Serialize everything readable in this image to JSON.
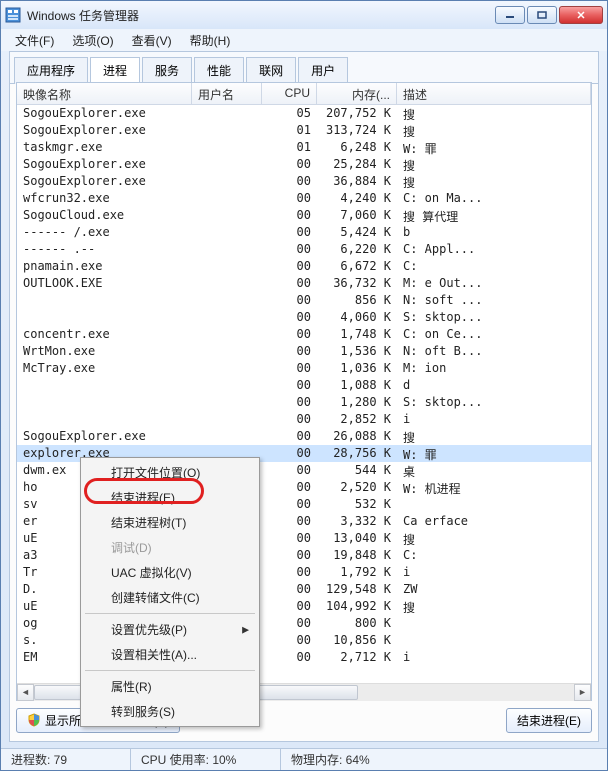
{
  "window": {
    "title": "Windows 任务管理器"
  },
  "menubar": [
    "文件(F)",
    "选项(O)",
    "查看(V)",
    "帮助(H)"
  ],
  "tabs": [
    "应用程序",
    "进程",
    "服务",
    "性能",
    "联网",
    "用户"
  ],
  "active_tab": 1,
  "columns": [
    "映像名称",
    "用户名",
    "CPU",
    "内存(...",
    "描述"
  ],
  "rows": [
    {
      "name": "SogouExplorer.exe",
      "user": "",
      "cpu": "05",
      "mem": "207,752 K",
      "desc": "搜"
    },
    {
      "name": "SogouExplorer.exe",
      "user": "",
      "cpu": "01",
      "mem": "313,724 K",
      "desc": "搜"
    },
    {
      "name": "taskmgr.exe",
      "user": "",
      "cpu": "01",
      "mem": "6,248 K",
      "desc": "W:             罪"
    },
    {
      "name": "SogouExplorer.exe",
      "user": "",
      "cpu": "00",
      "mem": "25,284 K",
      "desc": "搜"
    },
    {
      "name": "SogouExplorer.exe",
      "user": "",
      "cpu": "00",
      "mem": "36,884 K",
      "desc": "搜"
    },
    {
      "name": "wfcrun32.exe",
      "user": "",
      "cpu": "00",
      "mem": "4,240 K",
      "desc": "C:          on Ma..."
    },
    {
      "name": "SogouCloud.exe",
      "user": "",
      "cpu": "00",
      "mem": "7,060 K",
      "desc": "搜          算代理"
    },
    {
      "name": "------ /.exe",
      "user": "",
      "cpu": "00",
      "mem": "5,424 K",
      "desc": "b"
    },
    {
      "name": "------ .--",
      "user": "",
      "cpu": "00",
      "mem": "6,220 K",
      "desc": "C:           Appl..."
    },
    {
      "name": "pnamain.exe",
      "user": "",
      "cpu": "00",
      "mem": "6,672 K",
      "desc": "C:"
    },
    {
      "name": "OUTLOOK.EXE",
      "user": "",
      "cpu": "00",
      "mem": "36,732 K",
      "desc": "M:          e Out..."
    },
    {
      "name": "",
      "user": "",
      "cpu": "00",
      "mem": "856 K",
      "desc": "N:          soft ..."
    },
    {
      "name": "",
      "user": "",
      "cpu": "00",
      "mem": "4,060 K",
      "desc": "S:          sktop..."
    },
    {
      "name": "concentr.exe",
      "user": "",
      "cpu": "00",
      "mem": "1,748 K",
      "desc": "C:          on Ce..."
    },
    {
      "name": "WrtMon.exe",
      "user": "",
      "cpu": "00",
      "mem": "1,536 K",
      "desc": "N:          oft B..."
    },
    {
      "name": "McTray.exe",
      "user": "",
      "cpu": "00",
      "mem": "1,036 K",
      "desc": "M:          ion"
    },
    {
      "name": "",
      "user": "",
      "cpu": "00",
      "mem": "1,088 K",
      "desc": "d"
    },
    {
      "name": "",
      "user": "",
      "cpu": "00",
      "mem": "1,280 K",
      "desc": "S:          sktop..."
    },
    {
      "name": "",
      "user": "",
      "cpu": "00",
      "mem": "2,852 K",
      "desc": "i"
    },
    {
      "name": "SogouExplorer.exe",
      "user": "",
      "cpu": "00",
      "mem": "26,088 K",
      "desc": "搜"
    },
    {
      "name": "explorer.exe",
      "user": "",
      "cpu": "00",
      "mem": "28,756 K",
      "desc": "W:             罪",
      "selected": true
    },
    {
      "name": "dwm.ex",
      "user": "",
      "cpu": "00",
      "mem": "544 K",
      "desc": "桌"
    },
    {
      "name": "ho",
      "user": "",
      "cpu": "00",
      "mem": "2,520 K",
      "desc": "W:          机进程"
    },
    {
      "name": "sv",
      "user": "",
      "cpu": "00",
      "mem": "532 K",
      "desc": ""
    },
    {
      "name": "er",
      "user": "",
      "cpu": "00",
      "mem": "3,332 K",
      "desc": "Ca          erface"
    },
    {
      "name": "uE",
      "user": "",
      "cpu": "00",
      "mem": "13,040 K",
      "desc": "搜"
    },
    {
      "name": "a3",
      "user": "",
      "cpu": "00",
      "mem": "19,848 K",
      "desc": "C:"
    },
    {
      "name": "Tr",
      "user": "",
      "cpu": "00",
      "mem": "1,792 K",
      "desc": "i"
    },
    {
      "name": "D.",
      "user": "",
      "cpu": "00",
      "mem": "129,548 K",
      "desc": "ZW"
    },
    {
      "name": "uE",
      "user": "",
      "cpu": "00",
      "mem": "104,992 K",
      "desc": "搜"
    },
    {
      "name": "og",
      "user": "",
      "cpu": "00",
      "mem": "800 K",
      "desc": ""
    },
    {
      "name": "s.",
      "user": "",
      "cpu": "00",
      "mem": "10,856 K",
      "desc": ""
    },
    {
      "name": "EM",
      "user": "",
      "cpu": "00",
      "mem": "2,712 K",
      "desc": "i"
    }
  ],
  "context_menu": {
    "items": [
      {
        "label": "打开文件位置(O)"
      },
      {
        "label": "结束进程(E)",
        "highlight": true
      },
      {
        "label": "结束进程树(T)"
      },
      {
        "label": "调试(D)",
        "disabled": true
      },
      {
        "label": "UAC 虚拟化(V)"
      },
      {
        "label": "创建转储文件(C)"
      },
      {
        "sep": true
      },
      {
        "label": "设置优先级(P)",
        "submenu": true
      },
      {
        "label": "设置相关性(A)..."
      },
      {
        "sep": true
      },
      {
        "label": "属性(R)"
      },
      {
        "label": "转到服务(S)"
      }
    ]
  },
  "buttons": {
    "show_all": "显示所有用户的进程(S)",
    "end_process": "结束进程(E)"
  },
  "status": {
    "procs": "进程数: 79",
    "cpu": "CPU 使用率: 10%",
    "mem": "物理内存: 64%"
  }
}
